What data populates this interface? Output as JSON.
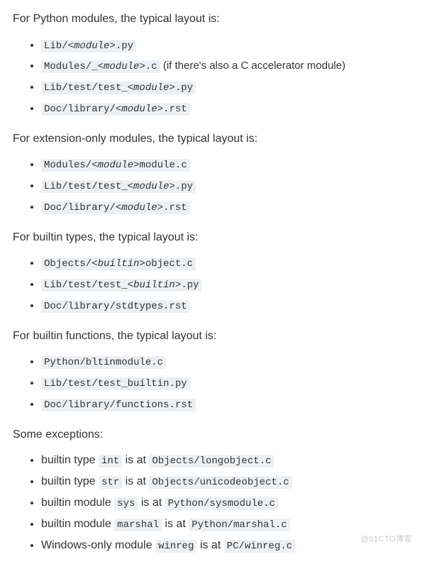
{
  "watermark": "@51CTO博客",
  "sections": [
    {
      "heading": "For Python modules, the typical layout is:",
      "items": [
        {
          "parts": [
            {
              "t": "c",
              "v": "Lib/"
            },
            {
              "t": "ph",
              "v": "<module>"
            },
            {
              "t": "c",
              "v": ".py"
            }
          ]
        },
        {
          "parts": [
            {
              "t": "c",
              "v": "Modules/_"
            },
            {
              "t": "ph",
              "v": "<module>"
            },
            {
              "t": "c",
              "v": ".c"
            }
          ],
          "suffix": " (if there's also a C accelerator module)"
        },
        {
          "parts": [
            {
              "t": "c",
              "v": "Lib/test/test_"
            },
            {
              "t": "ph",
              "v": "<module>"
            },
            {
              "t": "c",
              "v": ".py"
            }
          ]
        },
        {
          "parts": [
            {
              "t": "c",
              "v": "Doc/library/"
            },
            {
              "t": "ph",
              "v": "<module>"
            },
            {
              "t": "c",
              "v": ".rst"
            }
          ]
        }
      ]
    },
    {
      "heading": "For extension-only modules, the typical layout is:",
      "items": [
        {
          "parts": [
            {
              "t": "c",
              "v": "Modules/"
            },
            {
              "t": "ph",
              "v": "<module>"
            },
            {
              "t": "c",
              "v": "module.c"
            }
          ]
        },
        {
          "parts": [
            {
              "t": "c",
              "v": "Lib/test/test_"
            },
            {
              "t": "ph",
              "v": "<module>"
            },
            {
              "t": "c",
              "v": ".py"
            }
          ]
        },
        {
          "parts": [
            {
              "t": "c",
              "v": "Doc/library/"
            },
            {
              "t": "ph",
              "v": "<module>"
            },
            {
              "t": "c",
              "v": ".rst"
            }
          ]
        }
      ]
    },
    {
      "heading": "For builtin types, the typical layout is:",
      "items": [
        {
          "parts": [
            {
              "t": "c",
              "v": "Objects/"
            },
            {
              "t": "ph",
              "v": "<builtin>"
            },
            {
              "t": "c",
              "v": "object.c"
            }
          ]
        },
        {
          "parts": [
            {
              "t": "c",
              "v": "Lib/test/test_"
            },
            {
              "t": "ph",
              "v": "<builtin>"
            },
            {
              "t": "c",
              "v": ".py"
            }
          ]
        },
        {
          "parts": [
            {
              "t": "c",
              "v": "Doc/library/stdtypes.rst"
            }
          ]
        }
      ]
    },
    {
      "heading": "For builtin functions, the typical layout is:",
      "items": [
        {
          "parts": [
            {
              "t": "c",
              "v": "Python/bltinmodule.c"
            }
          ]
        },
        {
          "parts": [
            {
              "t": "c",
              "v": "Lib/test/test_builtin.py"
            }
          ]
        },
        {
          "parts": [
            {
              "t": "c",
              "v": "Doc/library/functions.rst"
            }
          ]
        }
      ]
    },
    {
      "heading": "Some exceptions:",
      "items": [
        {
          "prefix": "builtin type ",
          "parts": [
            {
              "t": "c",
              "v": "int"
            }
          ],
          "mid": " is at ",
          "parts2": [
            {
              "t": "c",
              "v": "Objects/longobject.c"
            }
          ]
        },
        {
          "prefix": "builtin type ",
          "parts": [
            {
              "t": "c",
              "v": "str"
            }
          ],
          "mid": " is at ",
          "parts2": [
            {
              "t": "c",
              "v": "Objects/unicodeobject.c"
            }
          ]
        },
        {
          "prefix": "builtin module ",
          "parts": [
            {
              "t": "c",
              "v": "sys"
            }
          ],
          "mid": " is at ",
          "parts2": [
            {
              "t": "c",
              "v": "Python/sysmodule.c"
            }
          ]
        },
        {
          "prefix": "builtin module ",
          "parts": [
            {
              "t": "c",
              "v": "marshal"
            }
          ],
          "mid": " is at ",
          "parts2": [
            {
              "t": "c",
              "v": "Python/marshal.c"
            }
          ]
        },
        {
          "prefix": "Windows-only module ",
          "parts": [
            {
              "t": "c",
              "v": "winreg"
            }
          ],
          "mid": " is at ",
          "parts2": [
            {
              "t": "c",
              "v": "PC/winreg.c"
            }
          ]
        }
      ]
    }
  ]
}
